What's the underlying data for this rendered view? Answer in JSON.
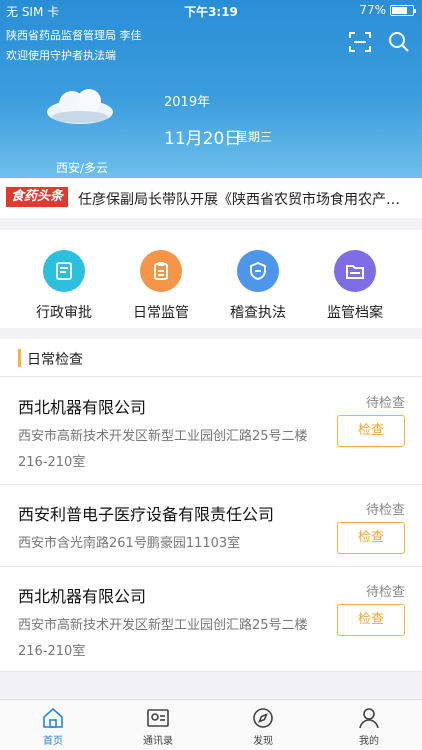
{
  "status": {
    "carrier": "无 SIM 卡",
    "time": "下午3:19",
    "battery": "77%",
    "battery_level": 0.77
  },
  "header": {
    "org": "陕西省药品监督管理局 李佳",
    "welcome": "欢迎使用守护者执法端",
    "year": "2019年",
    "date": "11月20日",
    "weekday": "星期三",
    "location": "西安/多云"
  },
  "news": {
    "logo": "食药头条",
    "headline": "任彦保副局长带队开展《陕西省农贸市场食用农产品质量安全管理办法》"
  },
  "quick": [
    {
      "label": "行政审批",
      "icon": "approval-icon",
      "color": "#2cc0dd"
    },
    {
      "label": "日常监管",
      "icon": "clipboard-icon",
      "color": "#f4954a"
    },
    {
      "label": "稽查执法",
      "icon": "badge-icon",
      "color": "#4e96ea"
    },
    {
      "label": "监管档案",
      "icon": "folder-icon",
      "color": "#7d6ee6"
    }
  ],
  "inspection": {
    "title": "日常检查",
    "items": [
      {
        "name": "西北机器有限公司",
        "address": "西安市高新技术开发区新型工业园创汇路25号二楼216-210室",
        "status": "待检查",
        "action": "检查"
      },
      {
        "name": "西安利普电子医疗设备有限责任公司",
        "address": "西安市含光南路261号鹏豪园11103室",
        "status": "待检查",
        "action": "检查"
      },
      {
        "name": "西北机器有限公司",
        "address": "西安市高新技术开发区新型工业园创汇路25号二楼216-210室",
        "status": "待检查",
        "action": "检查"
      }
    ]
  },
  "tabs": [
    {
      "label": "首页",
      "icon": "home-icon",
      "active": true
    },
    {
      "label": "通讯录",
      "icon": "contacts-icon",
      "active": false
    },
    {
      "label": "发现",
      "icon": "compass-icon",
      "active": false
    },
    {
      "label": "我的",
      "icon": "user-icon",
      "active": false
    }
  ],
  "colors": {
    "accent": "#2a86d6",
    "header": "#3b9ddd",
    "action": "#f4b33b"
  }
}
